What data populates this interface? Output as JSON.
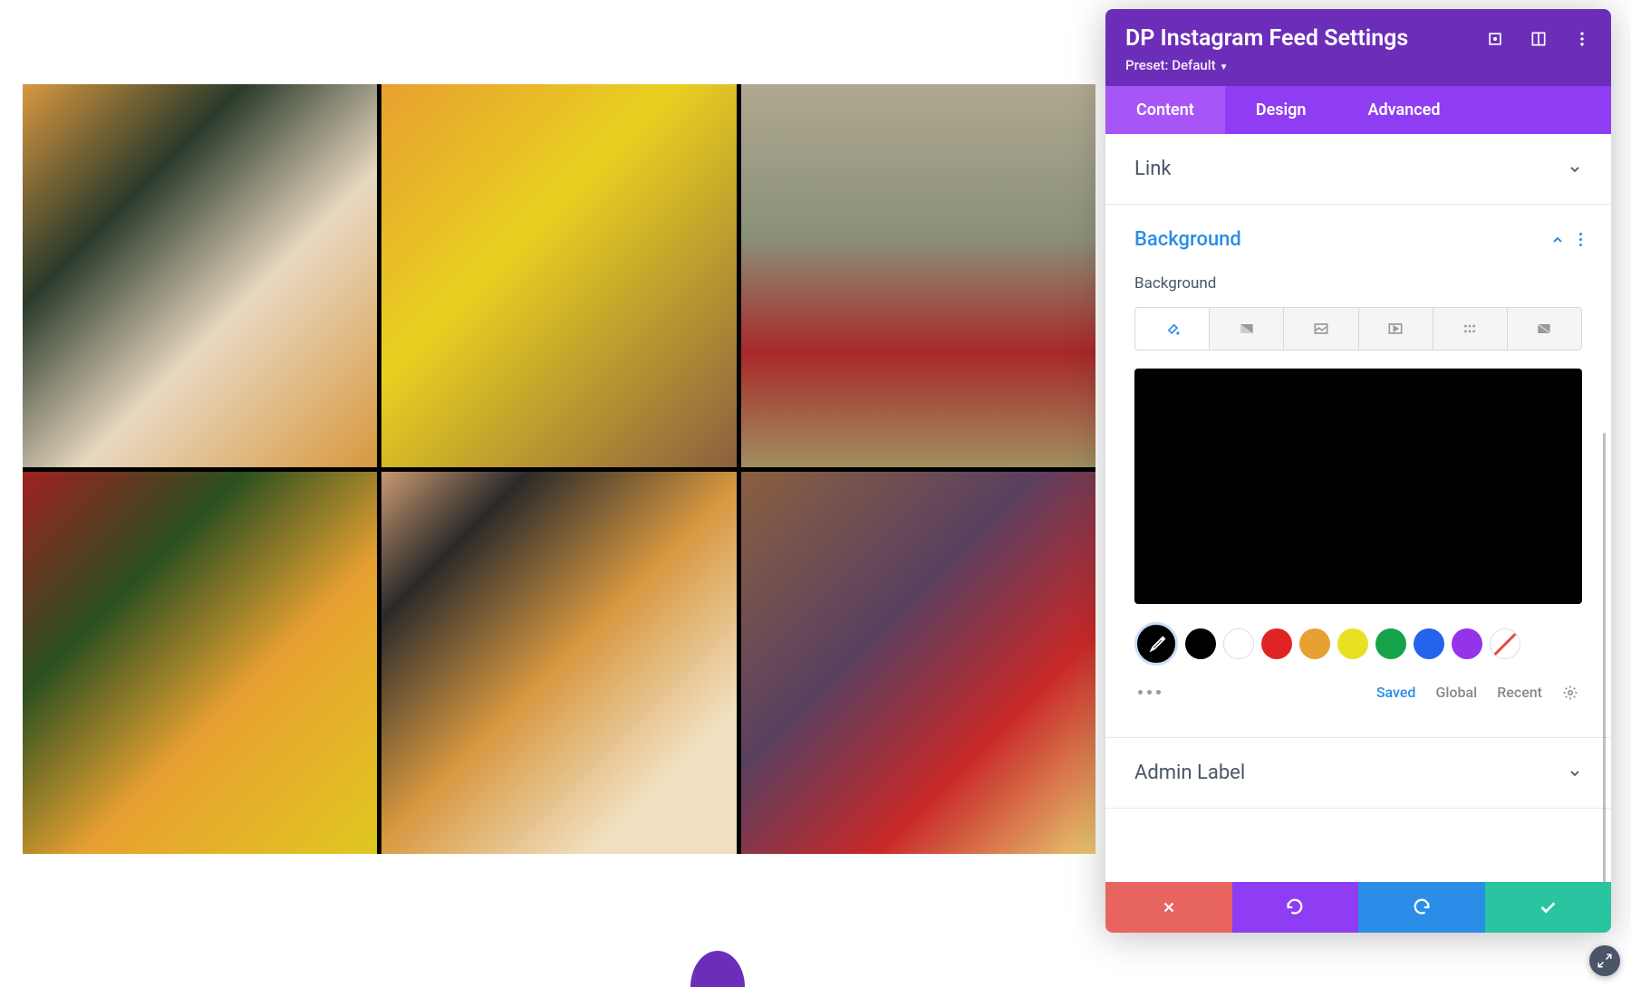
{
  "panel": {
    "title": "DP Instagram Feed Settings",
    "preset_label": "Preset: Default"
  },
  "tabs": {
    "content": "Content",
    "design": "Design",
    "advanced": "Advanced"
  },
  "sections": {
    "link": "Link",
    "background": "Background",
    "admin_label": "Admin Label"
  },
  "background": {
    "sublabel": "Background",
    "preview_color": "#000000"
  },
  "swatches": {
    "colors": [
      "#000000",
      "#ffffff",
      "#e02424",
      "#e8a030",
      "#e8e020",
      "#16a34a",
      "#2563eb",
      "#9333ea"
    ]
  },
  "color_tabs": {
    "saved": "Saved",
    "global": "Global",
    "recent": "Recent"
  }
}
